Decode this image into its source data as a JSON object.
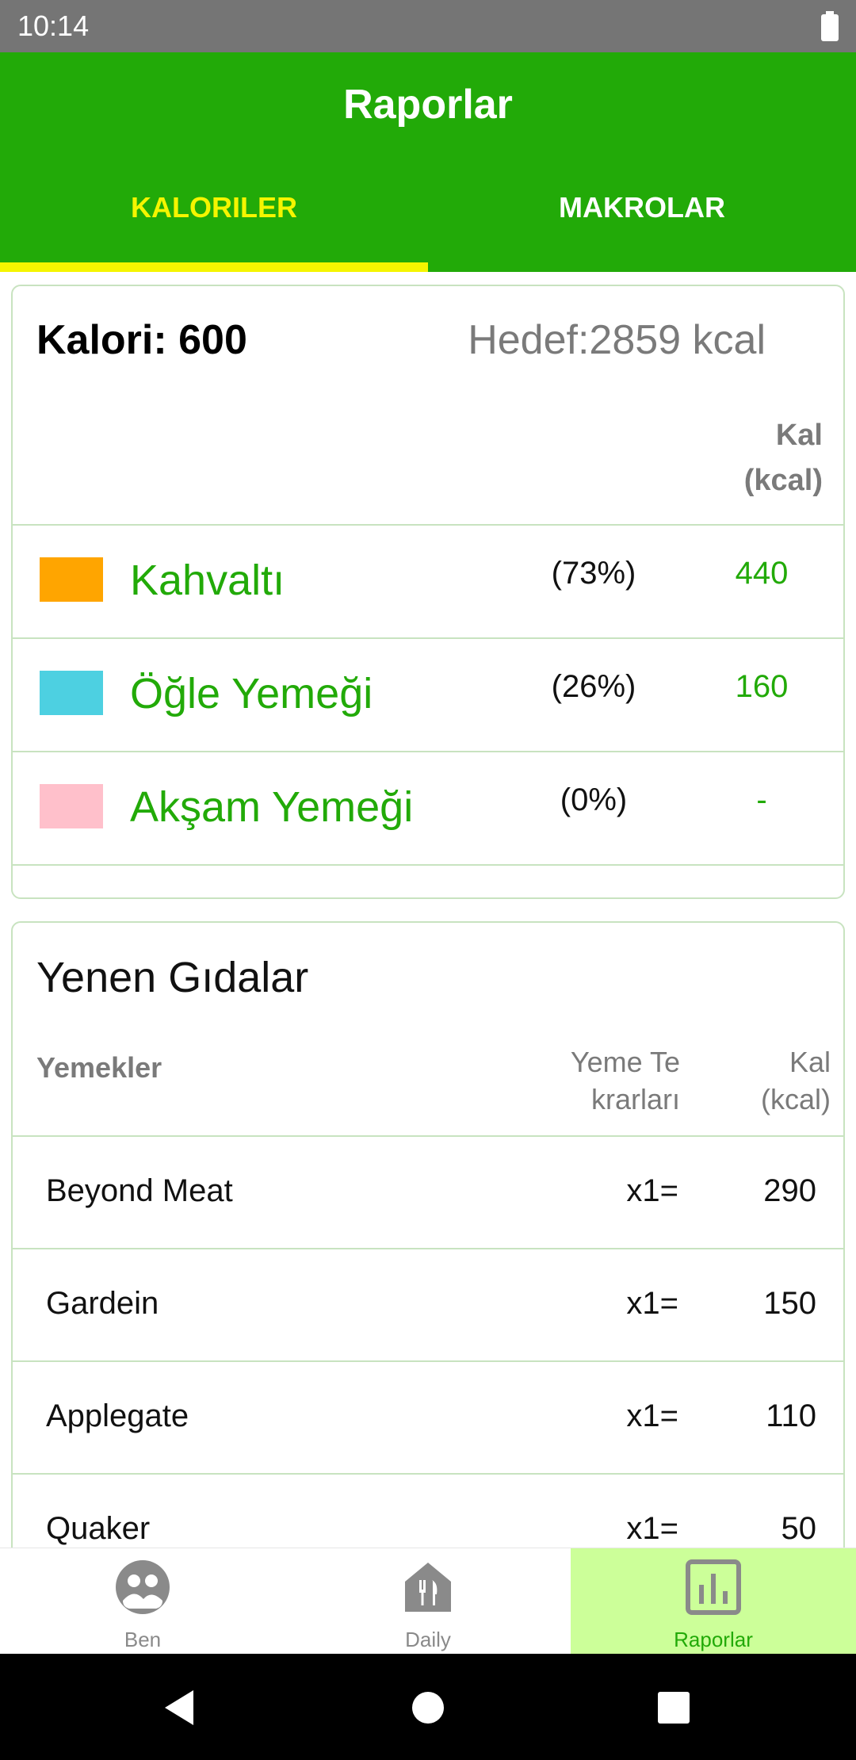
{
  "status_bar": {
    "time": "10:14"
  },
  "app_bar": {
    "title": "Raporlar"
  },
  "tabs": [
    {
      "label": "KALORILER",
      "active": true
    },
    {
      "label": "MAKROLAR",
      "active": false
    }
  ],
  "summary": {
    "calories_label": "Kalori: 600",
    "goal_label": "Hedef:2859 kcal",
    "kcal_col_line1": "Kal",
    "kcal_col_line2": "(kcal)"
  },
  "meals": [
    {
      "name": "Kahvaltı",
      "percent": "(73%)",
      "kcal": "440",
      "color": "#ffa500"
    },
    {
      "name": "Öğle Yemeği",
      "percent": "(26%)",
      "kcal": "160",
      "color": "#4dd0e1"
    },
    {
      "name": "Akşam Yemeği",
      "percent": "(0%)",
      "kcal": "-",
      "color": "#ffc0cb"
    }
  ],
  "foods_card": {
    "title": "Yenen Gıdalar",
    "col_food": "Yemekler",
    "col_count_line1": "Yeme Te",
    "col_count_line2": "krarları",
    "col_kcal_line1": "Kal",
    "col_kcal_line2": "(kcal)",
    "items": [
      {
        "name": "Beyond Meat",
        "count": "x1=",
        "kcal": "290"
      },
      {
        "name": "Gardein",
        "count": "x1=",
        "kcal": "150"
      },
      {
        "name": "Applegate",
        "count": "x1=",
        "kcal": "110"
      },
      {
        "name": "Quaker",
        "count": "x1=",
        "kcal": "50"
      }
    ]
  },
  "bottom_nav": [
    {
      "label": "Ben",
      "icon": "people-icon",
      "selected": false
    },
    {
      "label": "Daily",
      "icon": "restaurant-icon",
      "selected": false
    },
    {
      "label": "Raporlar",
      "icon": "bar-chart-icon",
      "selected": true
    }
  ],
  "colors": {
    "primary": "#22aa08",
    "accent": "#f5f500",
    "nav_selected_bg": "#ccff99"
  }
}
